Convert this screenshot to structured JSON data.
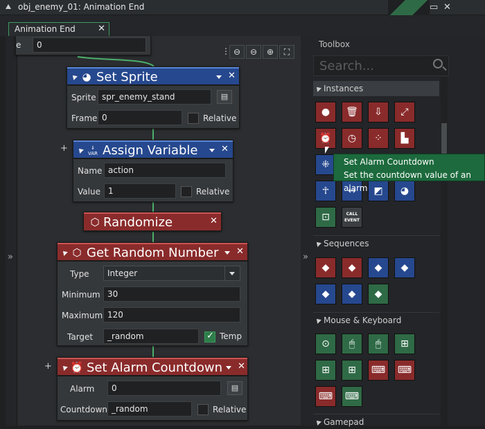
{
  "window": {
    "title": "obj_enemy_01: Animation End",
    "min": "▭",
    "close": "✕"
  },
  "tab": {
    "label": "Animation End",
    "close": "✕"
  },
  "panel_toggle": "»",
  "zoom_icons": [
    "⊖",
    "⊖",
    "⊕",
    "⛶"
  ],
  "partial_block": {
    "label": "e",
    "value": "0"
  },
  "blocks": {
    "set_sprite": {
      "title": "Set Sprite",
      "sprite_label": "Sprite",
      "sprite_value": "spr_enemy_stand",
      "frame_label": "Frame",
      "frame_value": "0",
      "relative_label": "Relative",
      "relative_checked": false,
      "icon": "pacman-icon"
    },
    "assign_variable": {
      "title": "Assign Variable",
      "icon_text": "VAR",
      "name_label": "Name",
      "name_value": "action",
      "value_label": "Value",
      "value_value": "1",
      "relative_label": "Relative",
      "relative_checked": false
    },
    "randomize": {
      "title": "Randomize",
      "icon": "dice-icon"
    },
    "get_random_number": {
      "title": "Get Random Number",
      "type_label": "Type",
      "type_value": "Integer",
      "min_label": "Minimum",
      "min_value": "30",
      "max_label": "Maximum",
      "max_value": "120",
      "target_label": "Target",
      "target_value": "_random",
      "temp_label": "Temp",
      "temp_checked": true
    },
    "set_alarm_countdown": {
      "title": "Set Alarm Countdown",
      "alarm_label": "Alarm",
      "alarm_value": "0",
      "countdown_label": "Countdown",
      "countdown_value": "_random",
      "relative_label": "Relative",
      "relative_checked": false
    }
  },
  "toolbox": {
    "title": "Toolbox",
    "search_placeholder": "Search...",
    "sections": {
      "instances": "Instances",
      "sequences": "Sequences",
      "mouse_keyboard": "Mouse & Keyboard",
      "gamepad": "Gamepad"
    },
    "call_event_label": "CALL EVENT"
  },
  "tooltip": {
    "title": "Set Alarm Countdown",
    "description": "Set the countdown value of an alarm"
  },
  "colors": {
    "action_blue": "#26488e",
    "action_red": "#8a2b2b",
    "accent_green": "#4caf6a"
  }
}
